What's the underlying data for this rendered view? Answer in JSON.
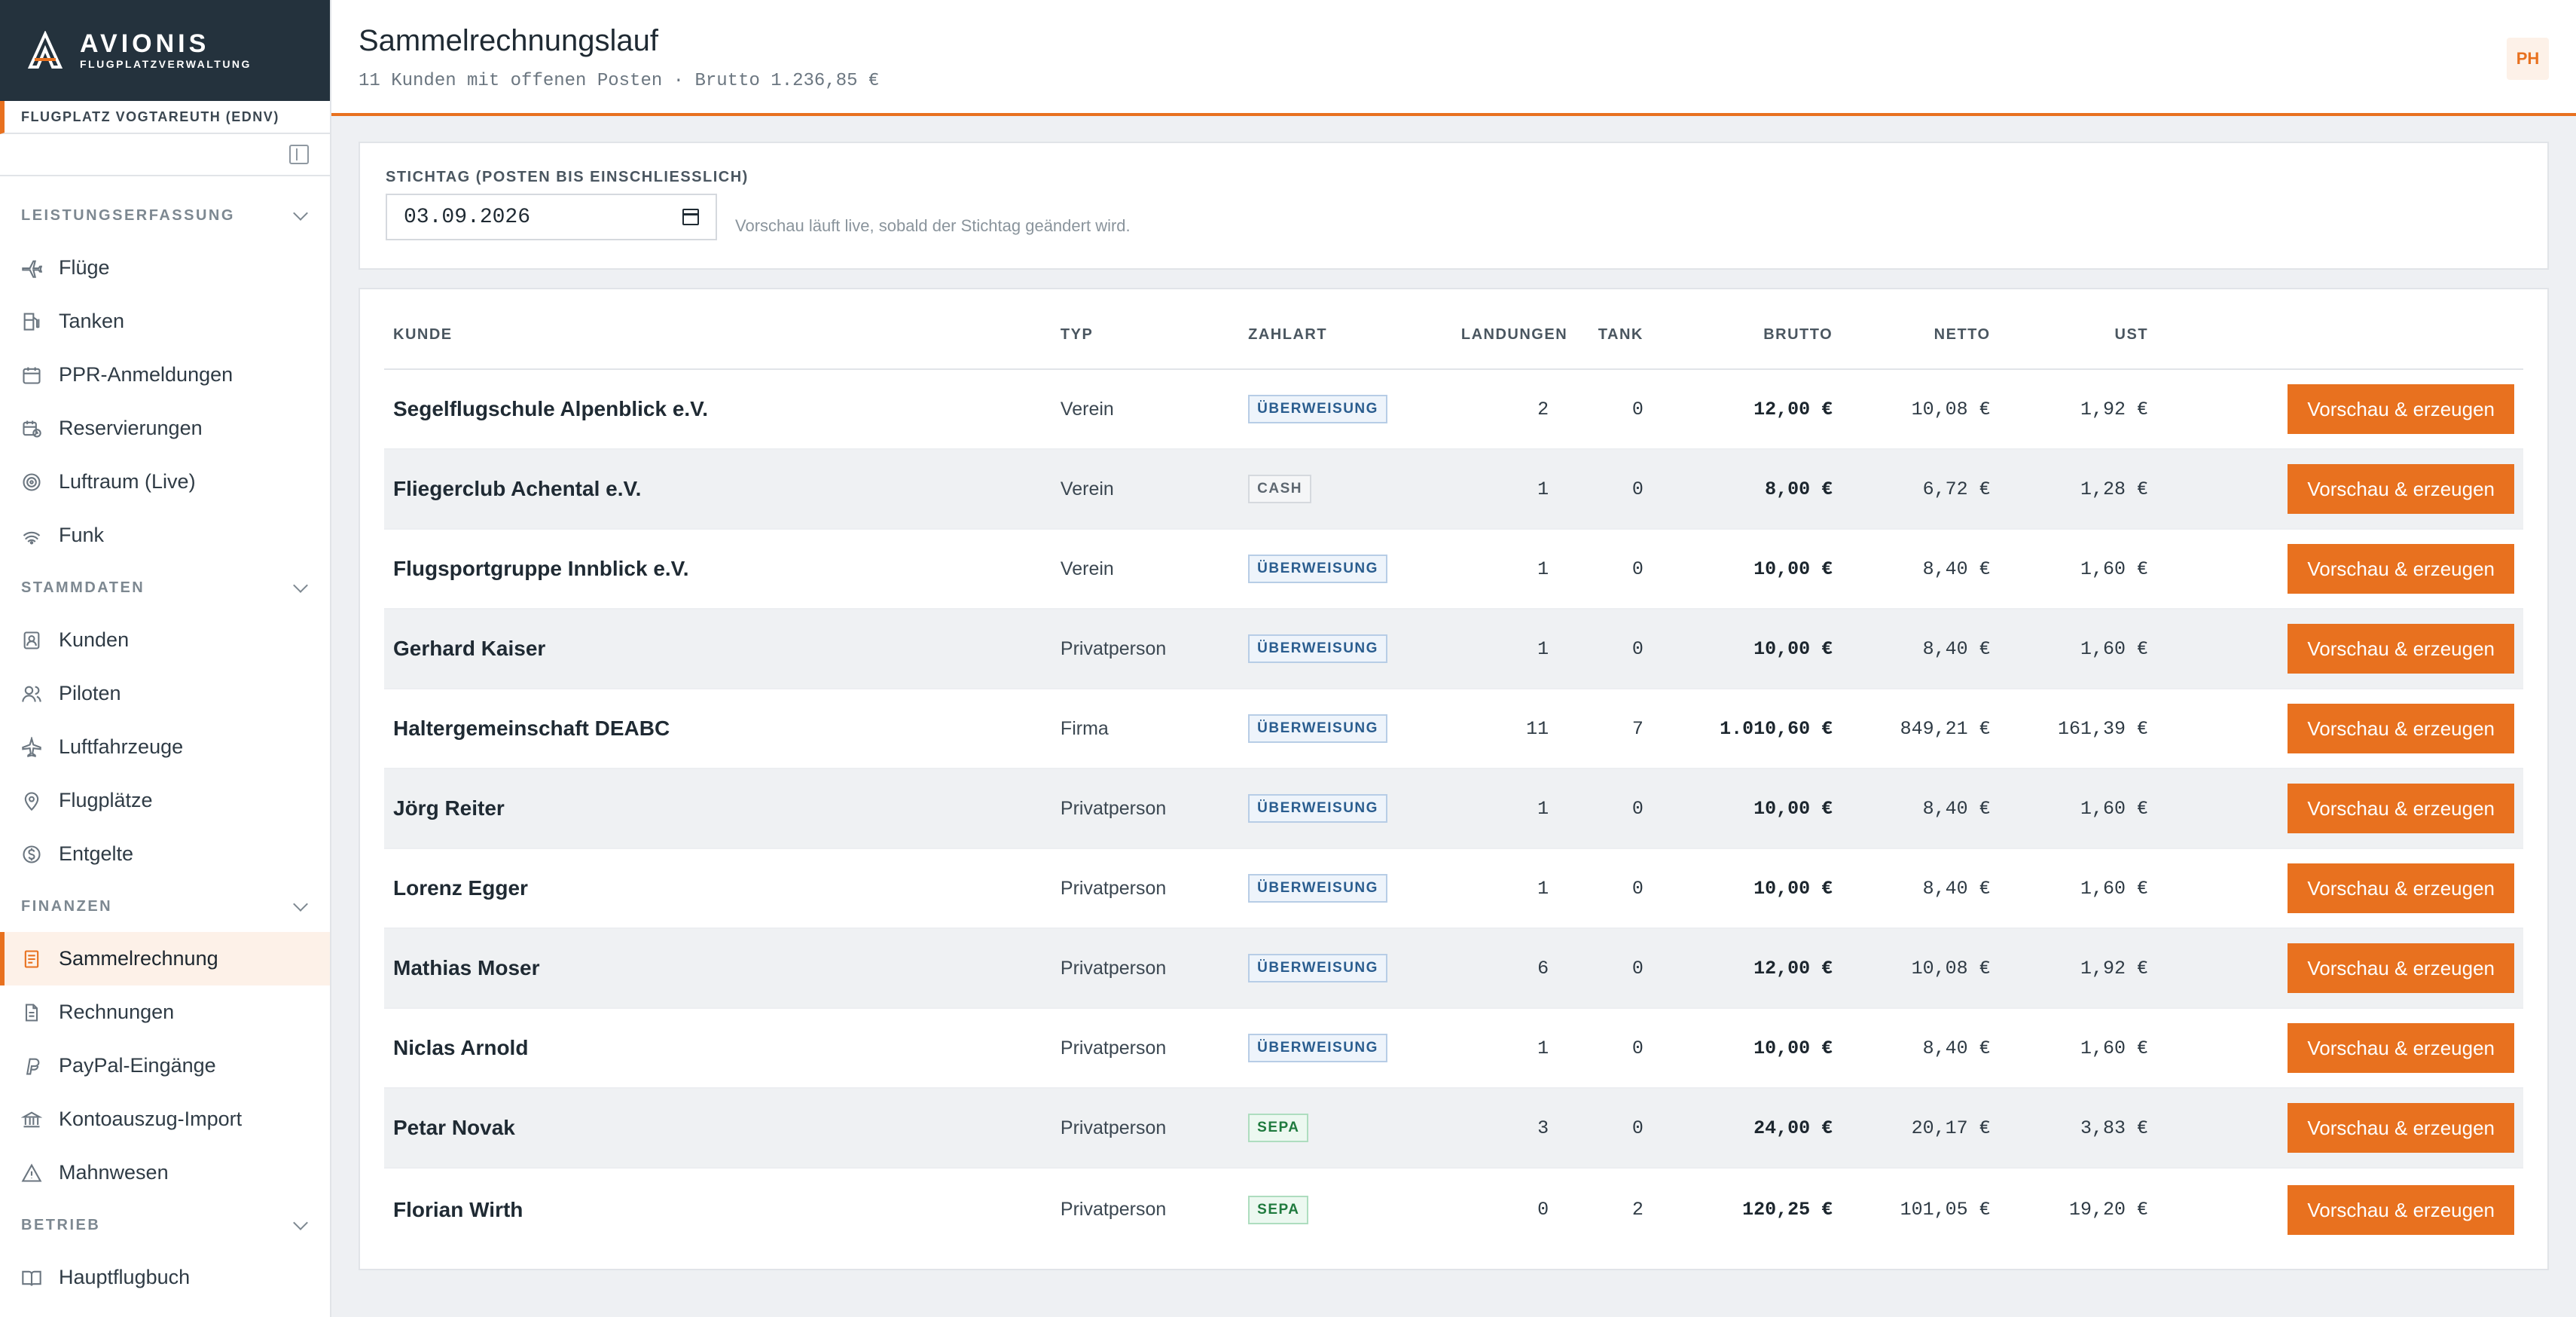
{
  "brand": {
    "name": "AVIONIS",
    "sub": "FLUGPLATZVERWALTUNG"
  },
  "site": "FLUGPLATZ VOGTAREUTH (EDNV)",
  "nav": {
    "sec1": "LEISTUNGSERFASSUNG",
    "sec2": "STAMMDATEN",
    "sec3": "FINANZEN",
    "sec4": "BETRIEB",
    "items": [
      "Flüge",
      "Tanken",
      "PPR-Anmeldungen",
      "Reservierungen",
      "Luftraum (Live)",
      "Funk",
      "Kunden",
      "Piloten",
      "Luftfahrzeuge",
      "Flugplätze",
      "Entgelte",
      "Sammelrechnung",
      "Rechnungen",
      "PayPal-Eingänge",
      "Kontoauszug-Import",
      "Mahnwesen",
      "Hauptflugbuch"
    ]
  },
  "header": {
    "title": "Sammelrechnungslauf",
    "subtitle": "11 Kunden mit offenen Posten · Brutto 1.236,85 €",
    "avatar": "PH"
  },
  "filter": {
    "label": "STICHTAG (POSTEN BIS EINSCHLIESSLICH)",
    "date": "03.09.2026",
    "hint": "Vorschau läuft live, sobald der Stichtag geändert wird."
  },
  "table": {
    "headers": {
      "kunde": "KUNDE",
      "typ": "TYP",
      "zahlart": "ZAHLART",
      "landungen": "LANDUNGEN",
      "tank": "TANK",
      "brutto": "BRUTTO",
      "netto": "NETTO",
      "ust": "UST"
    },
    "action_label": "Vorschau & erzeugen",
    "rows": [
      {
        "kunde": "Segelflugschule Alpenblick e.V.",
        "typ": "Verein",
        "zahlart": "ÜBERWEISUNG",
        "landungen": "2",
        "tank": "0",
        "brutto": "12,00 €",
        "netto": "10,08 €",
        "ust": "1,92 €"
      },
      {
        "kunde": "Fliegerclub Achental e.V.",
        "typ": "Verein",
        "zahlart": "CASH",
        "landungen": "1",
        "tank": "0",
        "brutto": "8,00 €",
        "netto": "6,72 €",
        "ust": "1,28 €"
      },
      {
        "kunde": "Flugsportgruppe Innblick e.V.",
        "typ": "Verein",
        "zahlart": "ÜBERWEISUNG",
        "landungen": "1",
        "tank": "0",
        "brutto": "10,00 €",
        "netto": "8,40 €",
        "ust": "1,60 €"
      },
      {
        "kunde": "Gerhard Kaiser",
        "typ": "Privatperson",
        "zahlart": "ÜBERWEISUNG",
        "landungen": "1",
        "tank": "0",
        "brutto": "10,00 €",
        "netto": "8,40 €",
        "ust": "1,60 €"
      },
      {
        "kunde": "Haltergemeinschaft DEABC",
        "typ": "Firma",
        "zahlart": "ÜBERWEISUNG",
        "landungen": "11",
        "tank": "7",
        "brutto": "1.010,60 €",
        "netto": "849,21 €",
        "ust": "161,39 €"
      },
      {
        "kunde": "Jörg Reiter",
        "typ": "Privatperson",
        "zahlart": "ÜBERWEISUNG",
        "landungen": "1",
        "tank": "0",
        "brutto": "10,00 €",
        "netto": "8,40 €",
        "ust": "1,60 €"
      },
      {
        "kunde": "Lorenz Egger",
        "typ": "Privatperson",
        "zahlart": "ÜBERWEISUNG",
        "landungen": "1",
        "tank": "0",
        "brutto": "10,00 €",
        "netto": "8,40 €",
        "ust": "1,60 €"
      },
      {
        "kunde": "Mathias Moser",
        "typ": "Privatperson",
        "zahlart": "ÜBERWEISUNG",
        "landungen": "6",
        "tank": "0",
        "brutto": "12,00 €",
        "netto": "10,08 €",
        "ust": "1,92 €"
      },
      {
        "kunde": "Niclas Arnold",
        "typ": "Privatperson",
        "zahlart": "ÜBERWEISUNG",
        "landungen": "1",
        "tank": "0",
        "brutto": "10,00 €",
        "netto": "8,40 €",
        "ust": "1,60 €"
      },
      {
        "kunde": "Petar Novak",
        "typ": "Privatperson",
        "zahlart": "SEPA",
        "landungen": "3",
        "tank": "0",
        "brutto": "24,00 €",
        "netto": "20,17 €",
        "ust": "3,83 €"
      },
      {
        "kunde": "Florian Wirth",
        "typ": "Privatperson",
        "zahlart": "SEPA",
        "landungen": "0",
        "tank": "2",
        "brutto": "120,25 €",
        "netto": "101,05 €",
        "ust": "19,20 €"
      }
    ]
  },
  "colors": {
    "accent": "#e8711f",
    "brand_bg": "#24323d"
  }
}
